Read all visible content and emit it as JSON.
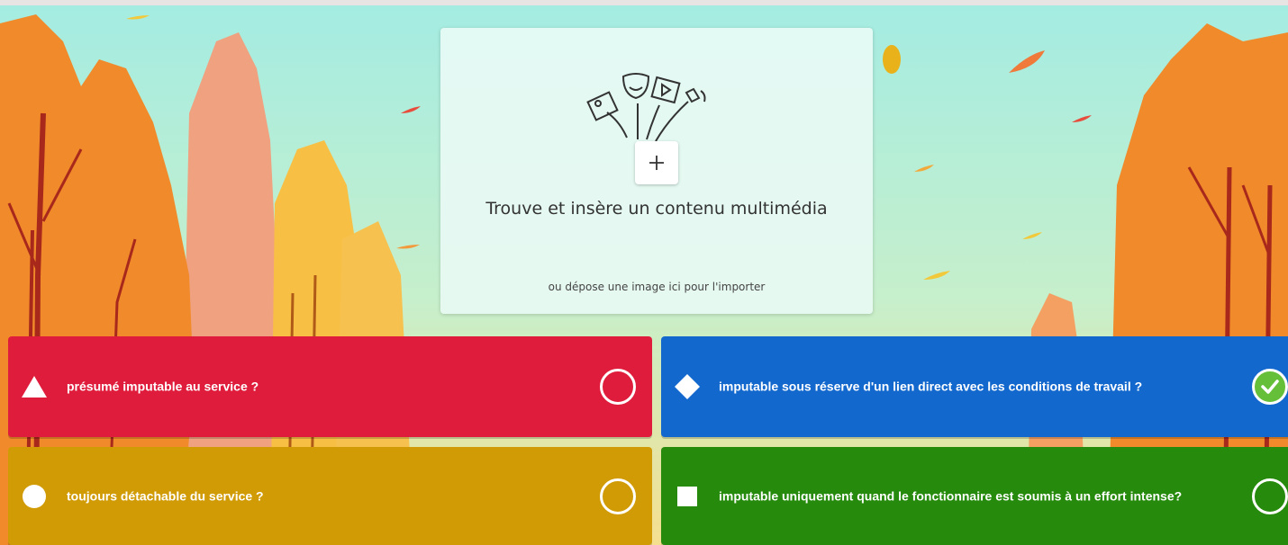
{
  "media_panel": {
    "title": "Trouve et insère un contenu multimédia",
    "subtitle": "ou dépose une image ici pour l'importer",
    "add_icon": "plus-icon",
    "illustration_icons": [
      "image-icon",
      "theatre-mask-icon",
      "video-icon",
      "speaker-icon"
    ]
  },
  "answers": [
    {
      "shape": "triangle",
      "text": "présumé imputable au service ?",
      "color": "#e01c3c",
      "correct": false
    },
    {
      "shape": "diamond",
      "text": "imputable sous réserve d'un lien direct avec les conditions de travail ?",
      "color": "#1368ce",
      "correct": true
    },
    {
      "shape": "circle",
      "text": "toujours détachable du service ?",
      "color": "#d19b05",
      "correct": false
    },
    {
      "shape": "square",
      "text": "imputable uniquement quand le fonctionnaire est soumis à un effort intense?",
      "color": "#268a0c",
      "correct": false
    }
  ],
  "colors": {
    "correct_mark": "#66bf39",
    "sky": "#a9ebe0"
  }
}
